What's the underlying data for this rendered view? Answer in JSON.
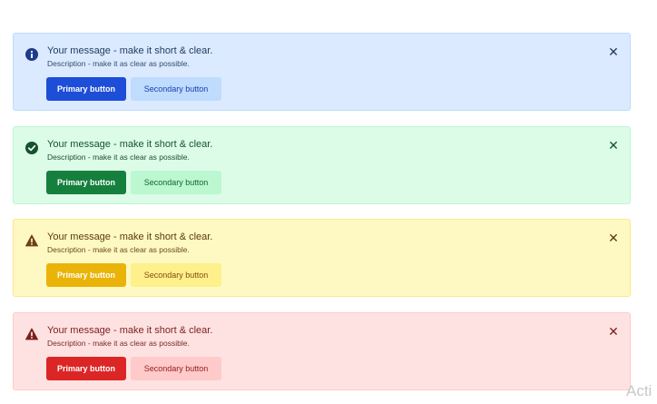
{
  "alerts": [
    {
      "variant": "info",
      "icon": "info-icon",
      "message": "Your message - make it short & clear.",
      "description": "Description - make it as clear as possible.",
      "primary_label": "Primary button",
      "secondary_label": "Secondary button",
      "close_glyph": "✕",
      "color": "#1e3a8a"
    },
    {
      "variant": "success",
      "icon": "check-circle-icon",
      "message": "Your message - make it short & clear.",
      "description": "Description - make it as clear as possible.",
      "primary_label": "Primary button",
      "secondary_label": "Secondary button",
      "close_glyph": "✕",
      "color": "#14532d"
    },
    {
      "variant": "warning",
      "icon": "warning-triangle-icon",
      "message": "Your message - make it short & clear.",
      "description": "Description - make it as clear as possible.",
      "primary_label": "Primary button",
      "secondary_label": "Secondary button",
      "close_glyph": "✕",
      "color": "#713f12"
    },
    {
      "variant": "error",
      "icon": "error-triangle-icon",
      "message": "Your message - make it short & clear.",
      "description": "Description - make it as clear as possible.",
      "primary_label": "Primary button",
      "secondary_label": "Secondary button",
      "close_glyph": "✕",
      "color": "#7f1d1d"
    }
  ],
  "watermark": "Acti"
}
